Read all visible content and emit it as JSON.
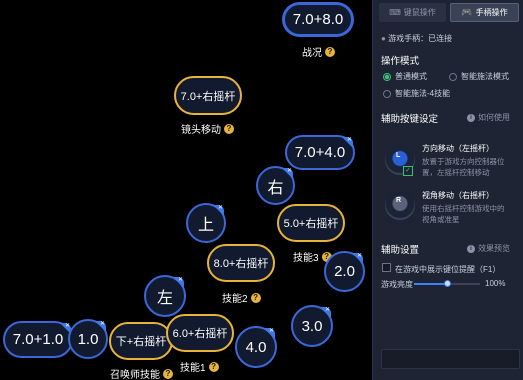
{
  "canvas": {
    "buttons": [
      {
        "id": "zhankuang",
        "text": "7.0+8.0",
        "style": "blue",
        "caption": "战况",
        "help": true
      },
      {
        "id": "jingtou",
        "text": "7.0+右摇杆",
        "style": "gold",
        "caption": "镜头移动",
        "help": true
      },
      {
        "id": "k740",
        "text": "7.0+4.0"
      },
      {
        "id": "you",
        "text": "右"
      },
      {
        "id": "shang",
        "text": "上"
      },
      {
        "id": "skill3",
        "text": "5.0+右摇杆",
        "style": "gold",
        "caption": "技能3",
        "help": true
      },
      {
        "id": "skill2",
        "text": "8.0+右摇杆",
        "style": "gold",
        "caption": "技能2",
        "help": true
      },
      {
        "id": "k20",
        "text": "2.0"
      },
      {
        "id": "zuo",
        "text": "左"
      },
      {
        "id": "k30",
        "text": "3.0"
      },
      {
        "id": "k710",
        "text": "7.0+1.0"
      },
      {
        "id": "k10",
        "text": "1.0"
      },
      {
        "id": "zhaohuan",
        "text": "下+右摇杆",
        "style": "gold",
        "caption": "召唤师技能",
        "help": true
      },
      {
        "id": "skill1",
        "text": "6.0+右摇杆",
        "style": "gold",
        "caption": "技能1",
        "help": true
      },
      {
        "id": "k40",
        "text": "4.0"
      }
    ]
  },
  "panel": {
    "tabs": {
      "keyboard": "键鼠操作",
      "gamepad": "手柄操作"
    },
    "gamepad_status": "游戏手柄：已连接",
    "mode_title": "操作模式",
    "modes": [
      "普通模式",
      "智能施法模式",
      "智能施法-4技能"
    ],
    "selected_mode": "普通模式",
    "assist_title": "辅助按键设定",
    "assist_help": "如何使用",
    "move": {
      "title": "方向移动（左摇杆）",
      "desc1": "放置于游戏方向控制器位",
      "desc2": "置，左摇杆控制移动"
    },
    "view": {
      "title": "视角移动（右摇杆）",
      "desc1": "使用右摇杆控制游戏中的",
      "desc2": "视角或准星"
    },
    "aux_title": "辅助设置",
    "aux_help": "效果预览",
    "show_hint_label": "在游戏中展示键位提醒（F1）",
    "opacity_label": "游戏亮度",
    "opacity_value": "100%",
    "opacity_level": 1.0
  },
  "colors": {
    "blue_border": "#3b67d9",
    "gold_border": "#e8b33a",
    "accent_green": "#39c07a",
    "slider_blue": "#3a82f7"
  }
}
